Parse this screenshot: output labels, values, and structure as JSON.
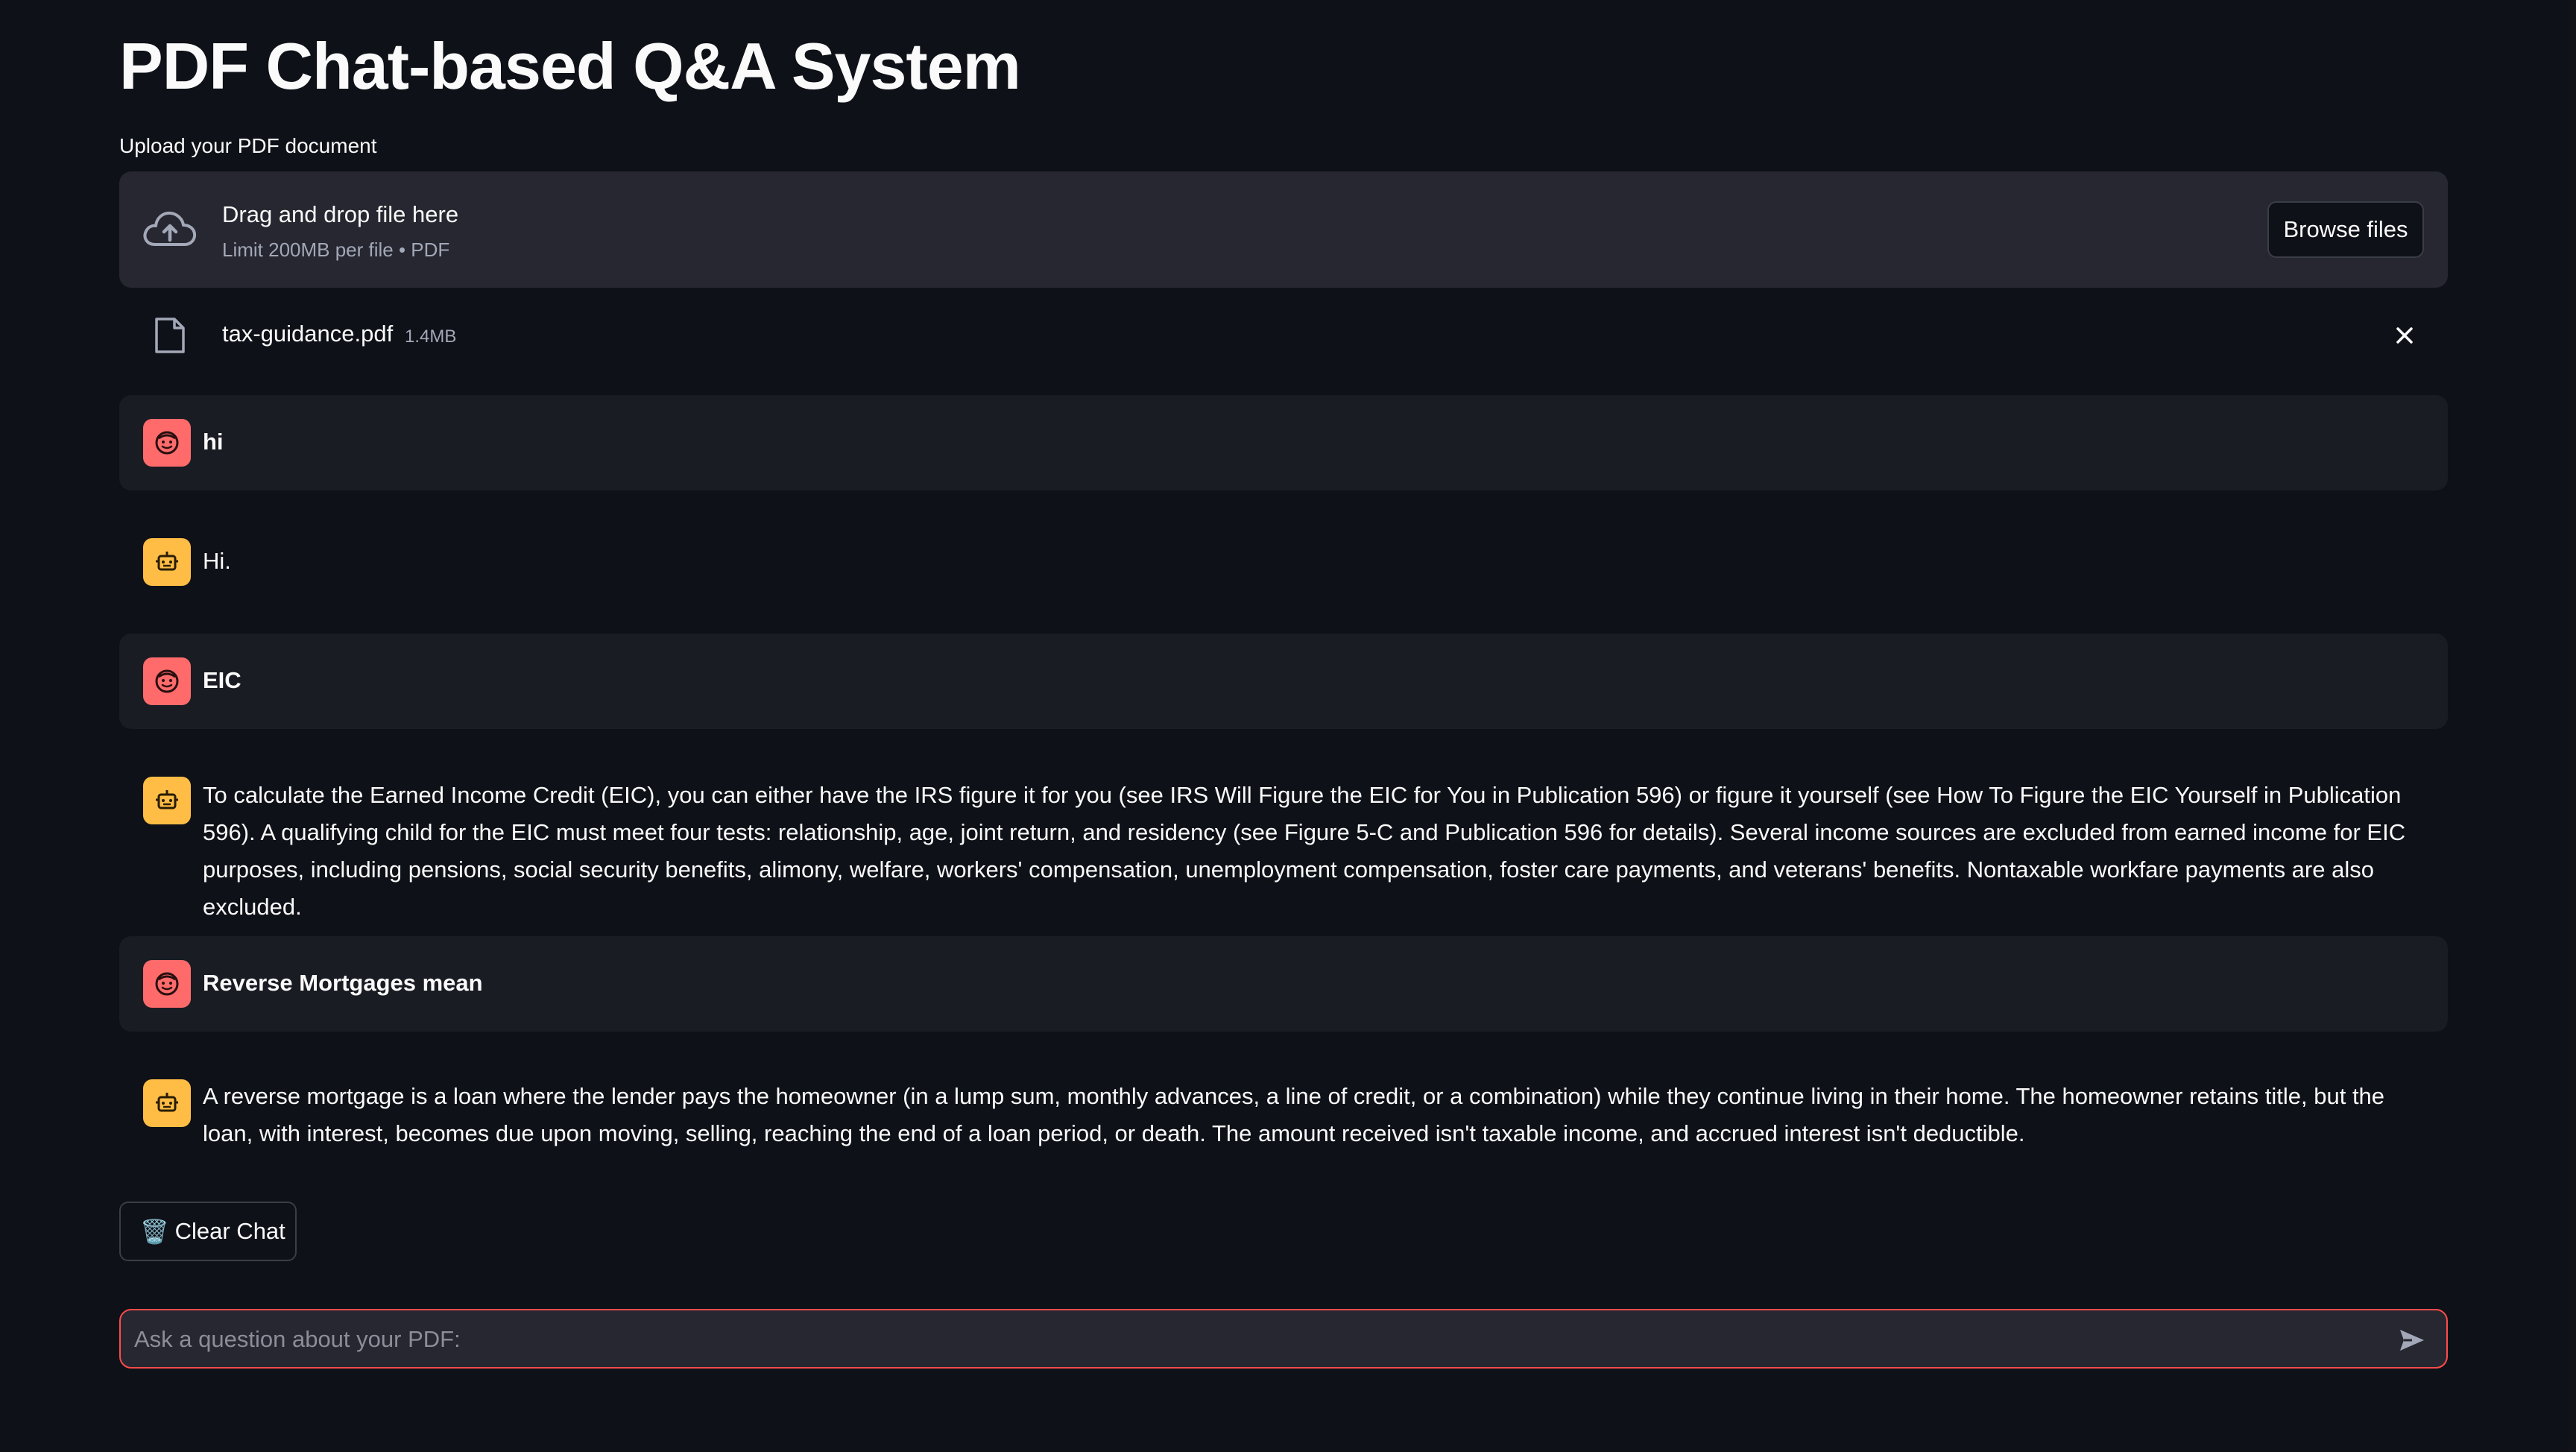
{
  "app": {
    "title": "PDF Chat-based Q&A System"
  },
  "uploader": {
    "label": "Upload your PDF document",
    "drop_title": "Drag and drop file here",
    "drop_sub": "Limit 200MB per file • PDF",
    "browse_label": "Browse files",
    "icon": "cloud-upload-icon"
  },
  "uploaded_file": {
    "name": "tax-guidance.pdf",
    "size": "1.4MB",
    "icon": "file-icon",
    "remove_icon": "close-icon"
  },
  "messages": [
    {
      "role": "user",
      "text": "hi"
    },
    {
      "role": "assistant",
      "text": "Hi."
    },
    {
      "role": "user",
      "text": "EIC"
    },
    {
      "role": "assistant",
      "text": "To calculate the Earned Income Credit (EIC), you can either have the IRS figure it for you (see IRS Will Figure the EIC for You in Publication 596) or figure it yourself (see How To Figure the EIC Yourself in Publication 596). A qualifying child for the EIC must meet four tests: relationship, age, joint return, and residency (see Figure 5-C and Publication 596 for details). Several income sources are excluded from earned income for EIC purposes, including pensions, social security benefits, alimony, welfare, workers' compensation, unemployment compensation, foster care payments, and veterans' benefits. Nontaxable workfare payments are also excluded."
    },
    {
      "role": "user",
      "text": "Reverse Mortgages mean"
    },
    {
      "role": "assistant",
      "text": "A reverse mortgage is a loan where the lender pays the homeowner (in a lump sum, monthly advances, a line of credit, or a combination) while they continue living in their home. The homeowner retains title, but the loan, with interest, becomes due upon moving, selling, reaching the end of a loan period, or death. The amount received isn't taxable income, and accrued interest isn't deductible."
    }
  ],
  "controls": {
    "clear_label": "Clear Chat",
    "clear_icon": "🗑️"
  },
  "chat_input": {
    "placeholder": "Ask a question about your PDF:",
    "value": "",
    "send_icon": "send-icon"
  },
  "colors": {
    "background": "#0e1117",
    "surface": "#262730",
    "user_bubble": "#1a1c24",
    "user_avatar": "#ff6b6b",
    "bot_avatar": "#ffbd45",
    "input_border": "#ff4b4b"
  }
}
